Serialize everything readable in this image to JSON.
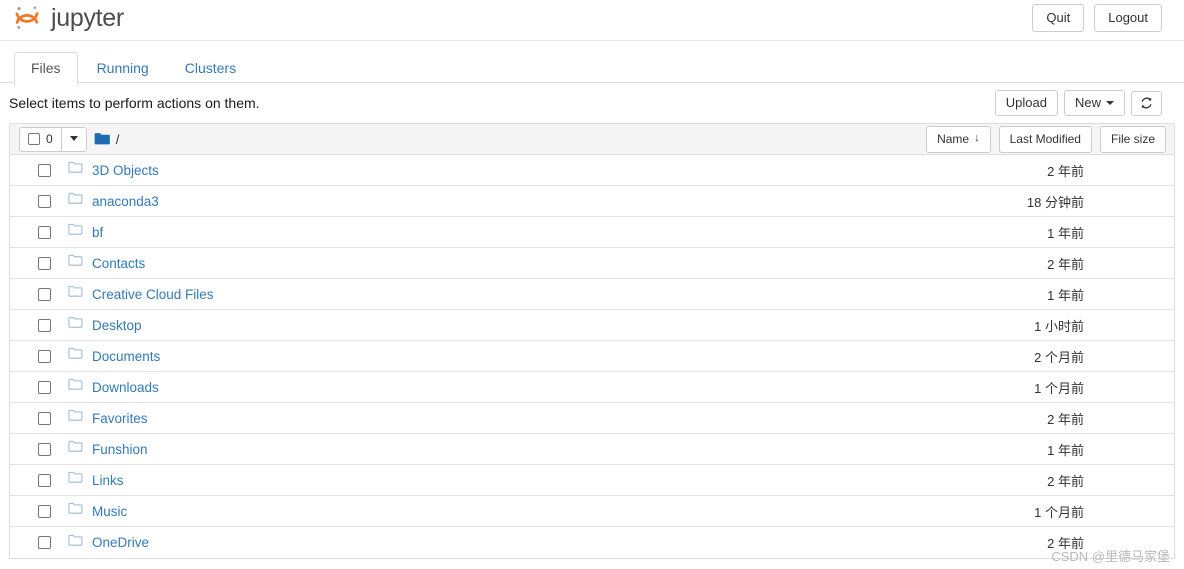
{
  "header": {
    "brand_text": "jupyter",
    "logo_icon": "jupyter-logo",
    "buttons": [
      {
        "label": "Quit",
        "name": "quit-button"
      },
      {
        "label": "Logout",
        "name": "logout-button"
      }
    ]
  },
  "tabs": [
    {
      "label": "Files",
      "name": "tab-files",
      "active": true
    },
    {
      "label": "Running",
      "name": "tab-running",
      "active": false
    },
    {
      "label": "Clusters",
      "name": "tab-clusters",
      "active": false
    }
  ],
  "actions": {
    "hint": "Select items to perform actions on them.",
    "upload_label": "Upload",
    "new_label": "New",
    "refresh_icon": "refresh-icon",
    "refresh_glyph": "↻"
  },
  "list_header": {
    "select_count": "0",
    "select_checkbox_icon": "select-all-checkbox",
    "select_caret_icon": "chevron-down-icon",
    "breadcrumb_folder_icon": "folder-icon",
    "breadcrumb_path": "/",
    "sort_name_label": "Name",
    "sort_name_arrow": "↓",
    "sort_modified_label": "Last Modified",
    "sort_size_label": "File size"
  },
  "colors": {
    "link": "#337ab7",
    "brand_orange": "#f37726",
    "header_bg": "#f5f5f5",
    "border": "#dddddd"
  },
  "rows": [
    {
      "name": "3D Objects",
      "icon": "folder-icon",
      "modified": "2 年前",
      "size": ""
    },
    {
      "name": "anaconda3",
      "icon": "folder-icon",
      "modified": "18 分钟前",
      "size": ""
    },
    {
      "name": "bf",
      "icon": "folder-icon",
      "modified": "1 年前",
      "size": ""
    },
    {
      "name": "Contacts",
      "icon": "folder-icon",
      "modified": "2 年前",
      "size": ""
    },
    {
      "name": "Creative Cloud Files",
      "icon": "folder-icon",
      "modified": "1 年前",
      "size": ""
    },
    {
      "name": "Desktop",
      "icon": "folder-icon",
      "modified": "1 小时前",
      "size": ""
    },
    {
      "name": "Documents",
      "icon": "folder-icon",
      "modified": "2 个月前",
      "size": ""
    },
    {
      "name": "Downloads",
      "icon": "folder-icon",
      "modified": "1 个月前",
      "size": ""
    },
    {
      "name": "Favorites",
      "icon": "folder-icon",
      "modified": "2 年前",
      "size": ""
    },
    {
      "name": "Funshion",
      "icon": "folder-icon",
      "modified": "1 年前",
      "size": ""
    },
    {
      "name": "Links",
      "icon": "folder-icon",
      "modified": "2 年前",
      "size": ""
    },
    {
      "name": "Music",
      "icon": "folder-icon",
      "modified": "1 个月前",
      "size": ""
    },
    {
      "name": "OneDrive",
      "icon": "folder-icon",
      "modified": "2 年前",
      "size": ""
    }
  ],
  "watermark": "CSDN @里德马家堡"
}
